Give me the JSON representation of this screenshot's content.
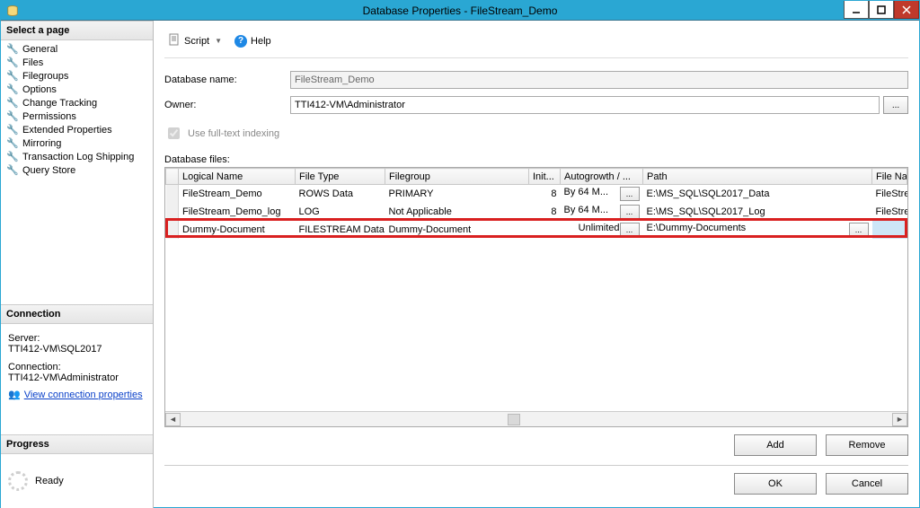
{
  "window": {
    "title": "Database Properties - FileStream_Demo"
  },
  "sidebar": {
    "select_header": "Select a page",
    "items": [
      {
        "label": "General"
      },
      {
        "label": "Files"
      },
      {
        "label": "Filegroups"
      },
      {
        "label": "Options"
      },
      {
        "label": "Change Tracking"
      },
      {
        "label": "Permissions"
      },
      {
        "label": "Extended Properties"
      },
      {
        "label": "Mirroring"
      },
      {
        "label": "Transaction Log Shipping"
      },
      {
        "label": "Query Store"
      }
    ],
    "connection_header": "Connection",
    "server_label": "Server:",
    "server_value": "TTI412-VM\\SQL2017",
    "connection_label": "Connection:",
    "connection_value": "TTI412-VM\\Administrator",
    "view_conn_link": "View connection properties",
    "progress_header": "Progress",
    "progress_status": "Ready"
  },
  "toolbar": {
    "script": "Script",
    "help": "Help"
  },
  "form": {
    "dbname_label": "Database name:",
    "dbname_value": "FileStream_Demo",
    "owner_label": "Owner:",
    "owner_value": "TTI412-VM\\Administrator",
    "fulltext_label": "Use full-text indexing",
    "dbfiles_label": "Database files:"
  },
  "grid": {
    "headers": {
      "logical": "Logical Name",
      "filetype": "File Type",
      "filegroup": "Filegroup",
      "init": "Init...",
      "autogrowth": "Autogrowth / ...",
      "path": "Path",
      "filename": "File Name"
    },
    "rows": [
      {
        "logical": "FileStream_Demo",
        "filetype": "ROWS Data",
        "filegroup": "PRIMARY",
        "init": "8",
        "autogrowth": "By 64 M...",
        "path": "E:\\MS_SQL\\SQL2017_Data",
        "filename": "FileStream_Demo.mdf"
      },
      {
        "logical": "FileStream_Demo_log",
        "filetype": "LOG",
        "filegroup": "Not Applicable",
        "init": "8",
        "autogrowth": "By 64 M...",
        "path": "E:\\MS_SQL\\SQL2017_Log",
        "filename": "FileStream_Demo_log.ldf"
      },
      {
        "logical": "Dummy-Document",
        "filetype": "FILESTREAM Data",
        "filegroup": "Dummy-Document",
        "init": "",
        "autogrowth": "Unlimited",
        "path": "E:\\Dummy-Documents",
        "filename": ""
      }
    ]
  },
  "buttons": {
    "add": "Add",
    "remove": "Remove",
    "ok": "OK",
    "cancel": "Cancel",
    "ellipsis": "..."
  }
}
